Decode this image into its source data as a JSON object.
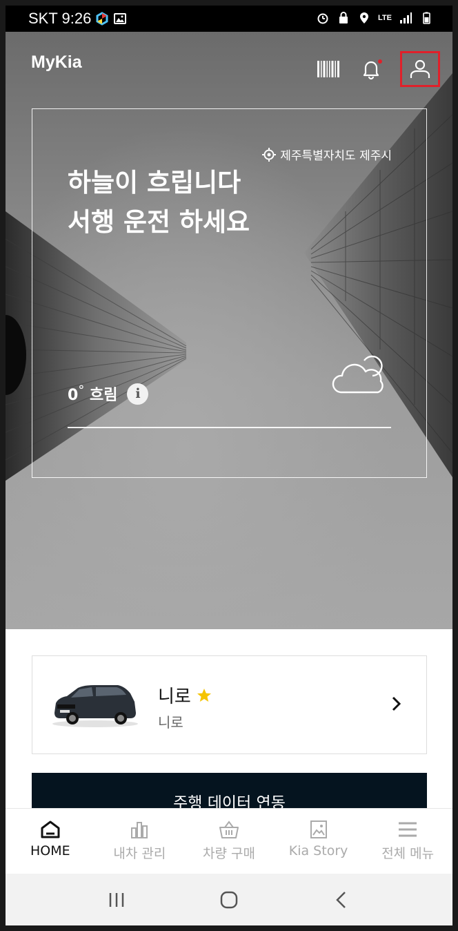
{
  "status_bar": {
    "carrier_time": "SKT 9:26",
    "network": "LTE"
  },
  "header": {
    "app_title": "MyKia"
  },
  "weather": {
    "location": "제주특별자치도 제주시",
    "headline_line1": "하늘이 흐립니다",
    "headline_line2": "서행 운전 하세요",
    "temperature": "0",
    "degree_symbol": "°",
    "condition": "흐림",
    "info_label": "i"
  },
  "vehicle": {
    "name": "니로",
    "model": "니로",
    "favorite": true
  },
  "driving_button": {
    "label": "주행 데이터 연동"
  },
  "bottom_nav": [
    {
      "label": "HOME",
      "icon": "home-icon",
      "active": true
    },
    {
      "label": "내차 관리",
      "icon": "bar-chart-icon",
      "active": false
    },
    {
      "label": "차량 구매",
      "icon": "basket-icon",
      "active": false
    },
    {
      "label": "Kia Story",
      "icon": "image-icon",
      "active": false
    },
    {
      "label": "전체 메뉴",
      "icon": "menu-icon",
      "active": false
    }
  ],
  "colors": {
    "accent_red": "#e0202a",
    "button_dark": "#05141f",
    "star": "#f5c400"
  }
}
